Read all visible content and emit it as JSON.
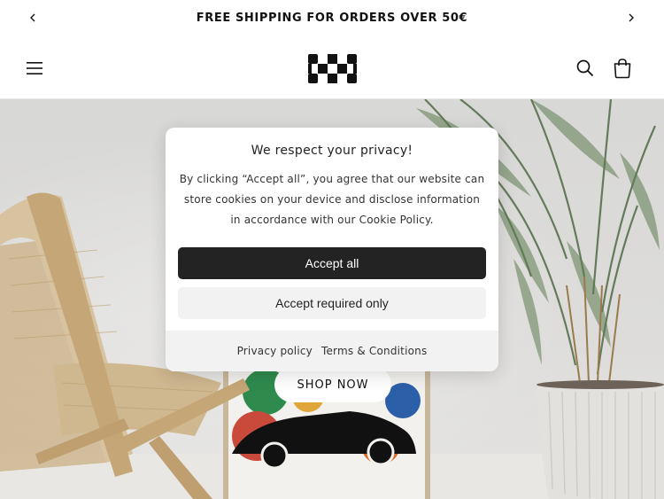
{
  "announcement": {
    "text": "FREE SHIPPING FOR ORDERS OVER 50€",
    "prev_icon": "chevron-left-icon",
    "next_icon": "chevron-right-icon"
  },
  "header": {
    "menu_icon": "hamburger-menu-icon",
    "logo": "checkered-flag-logo",
    "search_icon": "search-icon",
    "cart_icon": "cart-icon"
  },
  "hero": {
    "cta_label": "SHOP NOW"
  },
  "cookie_banner": {
    "title": "We respect your privacy!",
    "body": "By clicking “Accept all”, you agree that our website can store cookies on your device and disclose information in accordance with our Cookie Policy.",
    "accept_all_label": "Accept all",
    "accept_required_label": "Accept required only",
    "links": [
      "Privacy policy",
      "Terms & Conditions"
    ]
  },
  "colors": {
    "primary_button": "#232323",
    "secondary_button": "#f2f2f2",
    "footer_band": "#f2f2f2"
  }
}
